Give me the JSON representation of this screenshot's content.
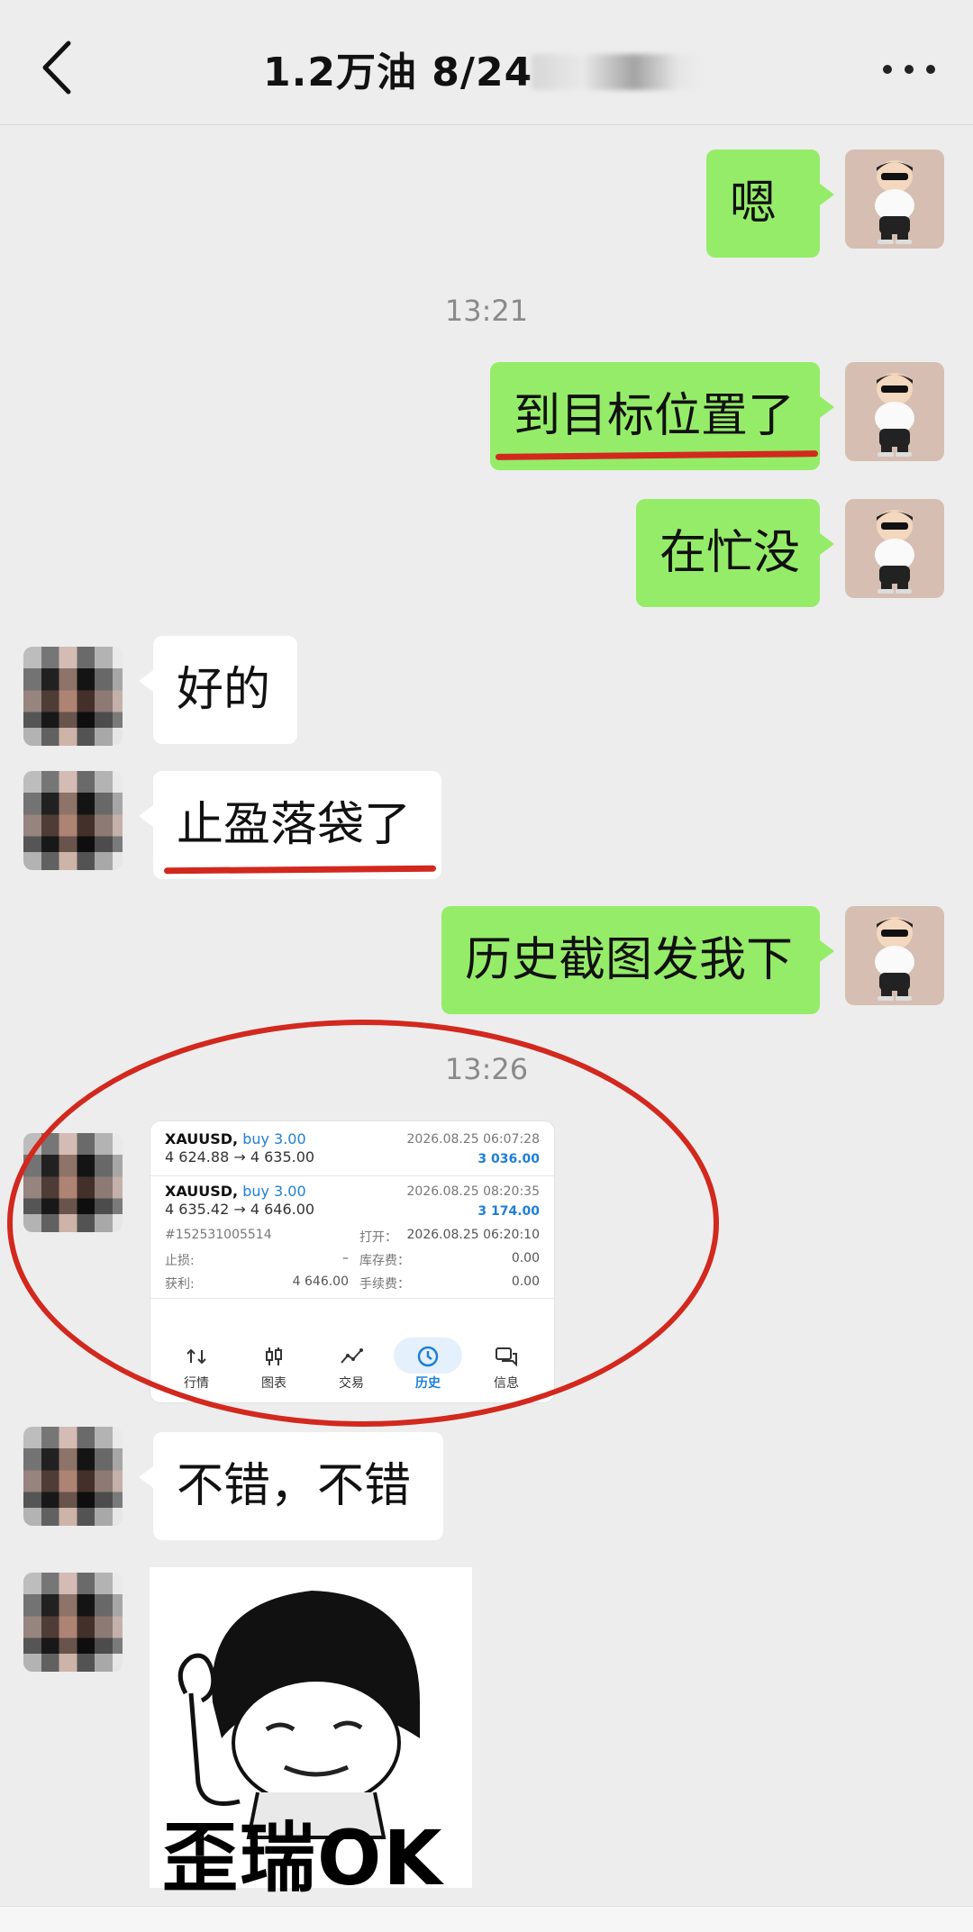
{
  "header": {
    "title": "1.2万油 8/24"
  },
  "messages": {
    "m1": "嗯",
    "ts1": "13:21",
    "m2": "到目标位置了",
    "m3": "在忙没",
    "m4": "好的",
    "m5": "止盈落袋了",
    "m6": "历史截图发我下",
    "ts2": "13:26",
    "m7": "不错，不错",
    "sticker_text": "歪瑞OK"
  },
  "screenshot": {
    "trade1": {
      "symbol": "XAUUSD,",
      "side": "buy 3.00",
      "prices": "4 624.88 → 4 635.00",
      "time": "2026.08.25 06:07:28",
      "profit": "3 036.00"
    },
    "trade2": {
      "symbol": "XAUUSD,",
      "side": "buy 3.00",
      "prices": "4 635.42 → 4 646.00",
      "time": "2026.08.25 08:20:35",
      "profit": "3 174.00",
      "ticket": "#152531005514",
      "open_label": "打开：",
      "open_value": "2026.08.25 06:20:10",
      "sl_label": "止损:",
      "sl_value": "–",
      "swap_label": "库存费：",
      "swap_value": "0.00",
      "tp_label": "获利:",
      "tp_value": "4 646.00",
      "fee_label": "手续费：",
      "fee_value": "0.00"
    },
    "tabs": [
      "行情",
      "图表",
      "交易",
      "历史",
      "信息"
    ],
    "active_tab": "历史",
    "accent_color": "#1f7fd6"
  },
  "colors": {
    "self_bubble": "#95ec69",
    "other_bubble": "#ffffff",
    "annotation_red": "#d2281e",
    "background": "#ededed"
  }
}
